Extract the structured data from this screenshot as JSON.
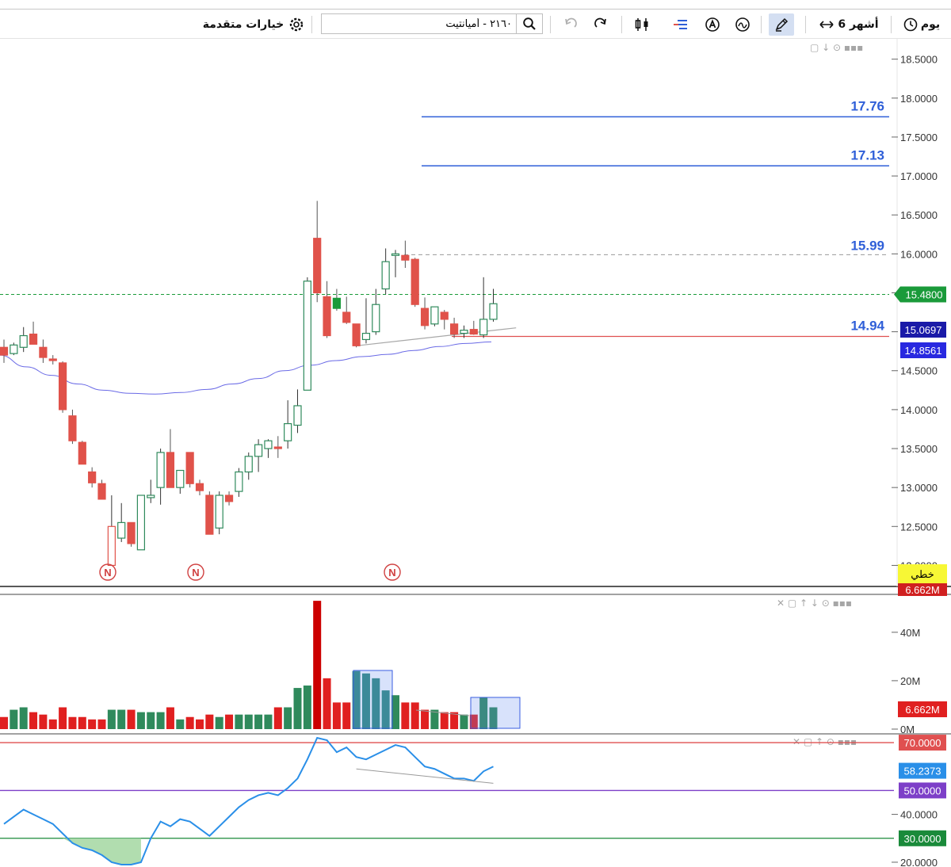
{
  "toolbar": {
    "period_label": "يوم",
    "range_label": "6 أشهر",
    "search_value": "٢١٦٠ - أميانتيت",
    "advanced_label": "خيارات متقدمة"
  },
  "colors": {
    "up": "#2f8a5c",
    "down": "#e0524a",
    "ma": "#6a6ae6",
    "rsi": "#2a8fe8",
    "resistance": "#2f5fd8",
    "support": "#e05050"
  },
  "chart_data": [
    {
      "type": "candlestick",
      "panel": "price",
      "ylim": [
        11.75,
        18.7
      ],
      "yticks": [
        "18.5000",
        "18.0000",
        "17.5000",
        "17.0000",
        "16.5000",
        "16.0000",
        "15.5000",
        "15.0000",
        "14.5000",
        "14.0000",
        "13.5000",
        "13.0000",
        "12.5000",
        "12.0000"
      ],
      "candles": [
        {
          "o": 14.8,
          "h": 14.9,
          "l": 14.6,
          "c": 14.7
        },
        {
          "o": 14.72,
          "h": 14.86,
          "l": 14.7,
          "c": 14.83
        },
        {
          "o": 14.8,
          "h": 15.06,
          "l": 14.74,
          "c": 14.95
        },
        {
          "o": 14.97,
          "h": 15.13,
          "l": 14.85,
          "c": 14.84
        },
        {
          "o": 14.8,
          "h": 14.9,
          "l": 14.6,
          "c": 14.67
        },
        {
          "o": 14.65,
          "h": 14.7,
          "l": 14.58,
          "c": 14.63
        },
        {
          "o": 14.6,
          "h": 14.62,
          "l": 13.96,
          "c": 14.0
        },
        {
          "o": 13.92,
          "h": 14.0,
          "l": 13.56,
          "c": 13.6
        },
        {
          "o": 13.58,
          "h": 13.6,
          "l": 13.3,
          "c": 13.3
        },
        {
          "o": 13.2,
          "h": 13.26,
          "l": 13.0,
          "c": 13.06
        },
        {
          "o": 13.05,
          "h": 13.1,
          "l": 12.85,
          "c": 12.85
        },
        {
          "o": 12.0,
          "h": 12.9,
          "l": 12.0,
          "c": 12.5
        },
        {
          "o": 12.35,
          "h": 12.8,
          "l": 12.3,
          "c": 12.55
        },
        {
          "o": 12.55,
          "h": 12.55,
          "l": 12.24,
          "c": 12.28
        },
        {
          "o": 12.2,
          "h": 12.9,
          "l": 12.2,
          "c": 12.9
        },
        {
          "o": 12.87,
          "h": 13.1,
          "l": 12.8,
          "c": 12.9
        },
        {
          "o": 13.0,
          "h": 13.5,
          "l": 12.78,
          "c": 13.45
        },
        {
          "o": 13.45,
          "h": 13.75,
          "l": 13.0,
          "c": 13.0
        },
        {
          "o": 13.0,
          "h": 13.2,
          "l": 12.92,
          "c": 13.22
        },
        {
          "o": 13.45,
          "h": 13.45,
          "l": 13.0,
          "c": 13.05
        },
        {
          "o": 13.05,
          "h": 13.1,
          "l": 12.9,
          "c": 12.96
        },
        {
          "o": 12.9,
          "h": 12.95,
          "l": 12.4,
          "c": 12.4
        },
        {
          "o": 12.48,
          "h": 12.95,
          "l": 12.4,
          "c": 12.9
        },
        {
          "o": 12.9,
          "h": 12.95,
          "l": 12.77,
          "c": 12.82
        },
        {
          "o": 12.95,
          "h": 13.25,
          "l": 12.88,
          "c": 13.2
        },
        {
          "o": 13.2,
          "h": 13.45,
          "l": 13.1,
          "c": 13.4
        },
        {
          "o": 13.4,
          "h": 13.62,
          "l": 13.2,
          "c": 13.55
        },
        {
          "o": 13.5,
          "h": 13.62,
          "l": 13.38,
          "c": 13.6
        },
        {
          "o": 13.52,
          "h": 13.66,
          "l": 13.38,
          "c": 13.5
        },
        {
          "o": 13.6,
          "h": 14.12,
          "l": 13.5,
          "c": 13.82
        },
        {
          "o": 13.8,
          "h": 14.26,
          "l": 13.7,
          "c": 14.05
        },
        {
          "o": 14.25,
          "h": 15.7,
          "l": 14.25,
          "c": 15.65
        },
        {
          "o": 16.2,
          "h": 16.68,
          "l": 15.38,
          "c": 15.5
        },
        {
          "o": 15.45,
          "h": 15.65,
          "l": 14.92,
          "c": 14.95
        },
        {
          "o": 15.43,
          "h": 15.55,
          "l": 15.27,
          "c": 15.3
        },
        {
          "o": 15.25,
          "h": 15.45,
          "l": 15.1,
          "c": 15.12
        },
        {
          "o": 15.1,
          "h": 15.1,
          "l": 14.8,
          "c": 14.82
        },
        {
          "o": 14.9,
          "h": 15.43,
          "l": 14.85,
          "c": 14.98
        },
        {
          "o": 15.0,
          "h": 15.55,
          "l": 14.96,
          "c": 15.35
        },
        {
          "o": 15.55,
          "h": 16.07,
          "l": 15.48,
          "c": 15.9
        },
        {
          "o": 15.98,
          "h": 16.05,
          "l": 15.7,
          "c": 16.0
        },
        {
          "o": 15.98,
          "h": 16.17,
          "l": 15.82,
          "c": 15.92
        },
        {
          "o": 15.93,
          "h": 15.95,
          "l": 15.32,
          "c": 15.35
        },
        {
          "o": 15.3,
          "h": 15.44,
          "l": 15.03,
          "c": 15.08
        },
        {
          "o": 15.1,
          "h": 15.32,
          "l": 15.07,
          "c": 15.32
        },
        {
          "o": 15.25,
          "h": 15.28,
          "l": 15.03,
          "c": 15.16
        },
        {
          "o": 15.1,
          "h": 15.18,
          "l": 14.92,
          "c": 14.97
        },
        {
          "o": 14.98,
          "h": 15.08,
          "l": 14.92,
          "c": 15.02
        },
        {
          "o": 15.03,
          "h": 15.14,
          "l": 14.96,
          "c": 14.97
        },
        {
          "o": 14.96,
          "h": 15.7,
          "l": 14.92,
          "c": 15.16
        },
        {
          "o": 15.16,
          "h": 15.55,
          "l": 15.13,
          "c": 15.36
        }
      ],
      "ma_line": [
        14.7,
        14.55,
        14.44,
        14.33,
        14.25,
        14.21,
        14.2,
        14.22,
        14.26,
        14.33,
        14.4,
        14.5,
        14.57,
        14.63,
        14.68,
        14.71,
        14.76,
        14.81,
        14.85,
        14.87
      ],
      "levels": [
        {
          "label": "17.76",
          "value": 17.76,
          "color": "#2f5fd8"
        },
        {
          "label": "17.13",
          "value": 17.13,
          "color": "#2f5fd8"
        },
        {
          "label": "15.99",
          "value": 15.99,
          "color": "#9a9a9a"
        },
        {
          "label": "14.94",
          "value": 14.94,
          "color": "#e05050"
        }
      ],
      "last_price": "15.4800",
      "trend_value_1": "15.0697",
      "trend_value_2": "14.8561",
      "line_type_label": "خطي",
      "volume_tag": "6.662M",
      "markers": [
        "N",
        "N",
        "N"
      ]
    },
    {
      "type": "bar",
      "panel": "volume",
      "ylim": [
        0,
        55
      ],
      "yticks": [
        "40M",
        "20M",
        "0M"
      ],
      "values": [
        5,
        8,
        9,
        7,
        6,
        4,
        9,
        5,
        5,
        4,
        4,
        8,
        8,
        8,
        7,
        7,
        7,
        9,
        4,
        5,
        4,
        6,
        5,
        6,
        6,
        6,
        6,
        6,
        9,
        9,
        17,
        18,
        53,
        21,
        11,
        11,
        24,
        23,
        21,
        16,
        14,
        11,
        11,
        8,
        8,
        7,
        7,
        6,
        6,
        13,
        9
      ],
      "last_value": "6.662M"
    },
    {
      "type": "line",
      "panel": "rsi",
      "ylim": [
        18,
        73
      ],
      "yticks": [
        "40.0000",
        "20.0000"
      ],
      "values": [
        36,
        39,
        42,
        40,
        38,
        36,
        32,
        28,
        26,
        25,
        23,
        20,
        19,
        19,
        20,
        30,
        37,
        35,
        38,
        37,
        34,
        31,
        35,
        39,
        43,
        46,
        48,
        49,
        48,
        51,
        55,
        63,
        72,
        71,
        66,
        68,
        64,
        63,
        65,
        67,
        69,
        68,
        64,
        60,
        59,
        57,
        55,
        55,
        54,
        58,
        60
      ],
      "levels": [
        {
          "label": "70.0000",
          "value": 70,
          "color": "#e05050"
        },
        {
          "label": "50.0000",
          "value": 50,
          "color": "#7d3fc8"
        },
        {
          "label": "30.0000",
          "value": 30,
          "color": "#1a8a3a"
        }
      ],
      "last_value": "58.2373"
    }
  ]
}
